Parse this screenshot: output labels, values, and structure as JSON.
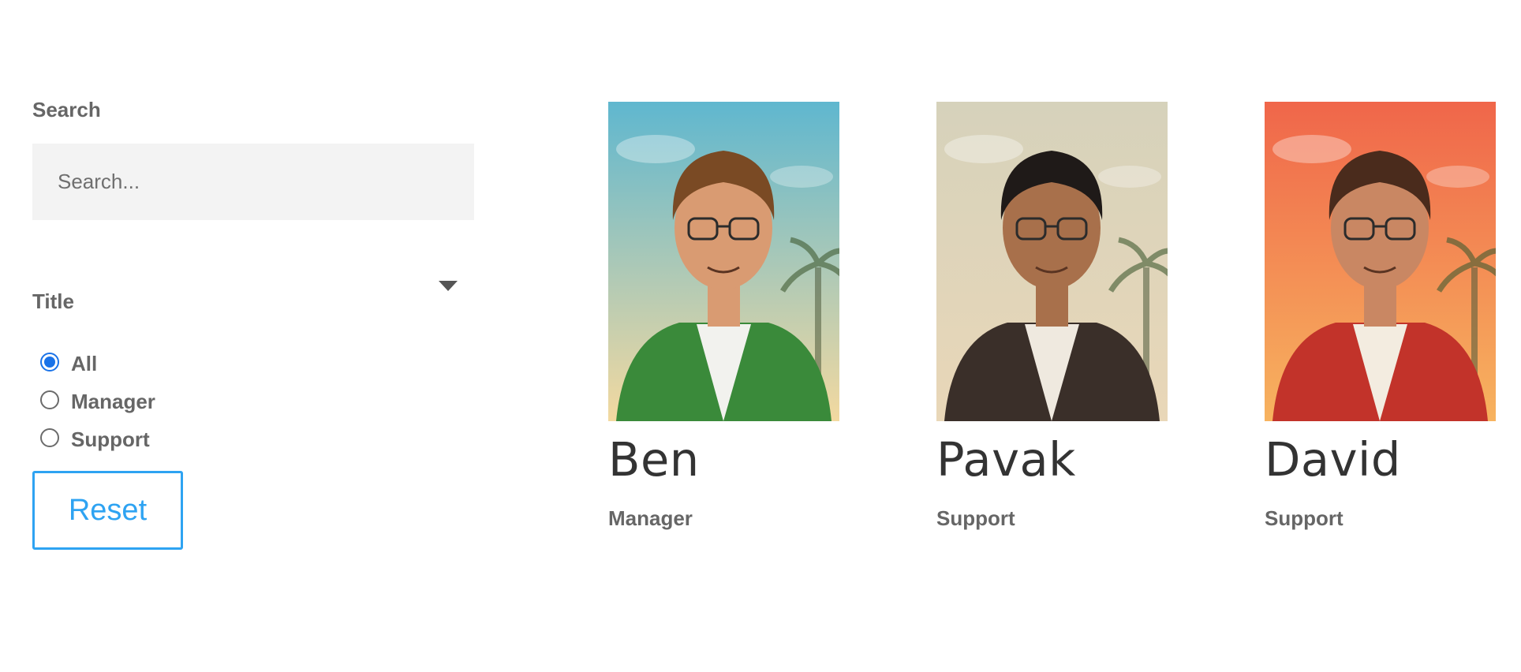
{
  "filters": {
    "search_label": "Search",
    "search_placeholder": "Search...",
    "search_value": "",
    "title_label": "Title",
    "options": [
      {
        "label": "All",
        "checked": true
      },
      {
        "label": "Manager",
        "checked": false
      },
      {
        "label": "Support",
        "checked": false
      }
    ],
    "reset_label": "Reset"
  },
  "members": [
    {
      "name": "Ben",
      "role": "Manager",
      "photo": {
        "bg_top": "#5fb7cf",
        "bg_bottom": "#f3d9a0",
        "jacket": "#3a8a3a",
        "shirt": "#f2f2ee",
        "hair": "#7a4a24",
        "skin": "#d99b72"
      }
    },
    {
      "name": "Pavak",
      "role": "Support",
      "photo": {
        "bg_top": "#d6d2bb",
        "bg_bottom": "#e9d7b8",
        "jacket": "#3a2f29",
        "shirt": "#efe9df",
        "hair": "#1f1a18",
        "skin": "#a8704b"
      }
    },
    {
      "name": "David",
      "role": "Support",
      "photo": {
        "bg_top": "#f0664a",
        "bg_bottom": "#f7b35f",
        "jacket": "#c2332a",
        "shirt": "#f3ece0",
        "hair": "#4a2b1c",
        "skin": "#c98763"
      }
    }
  ]
}
